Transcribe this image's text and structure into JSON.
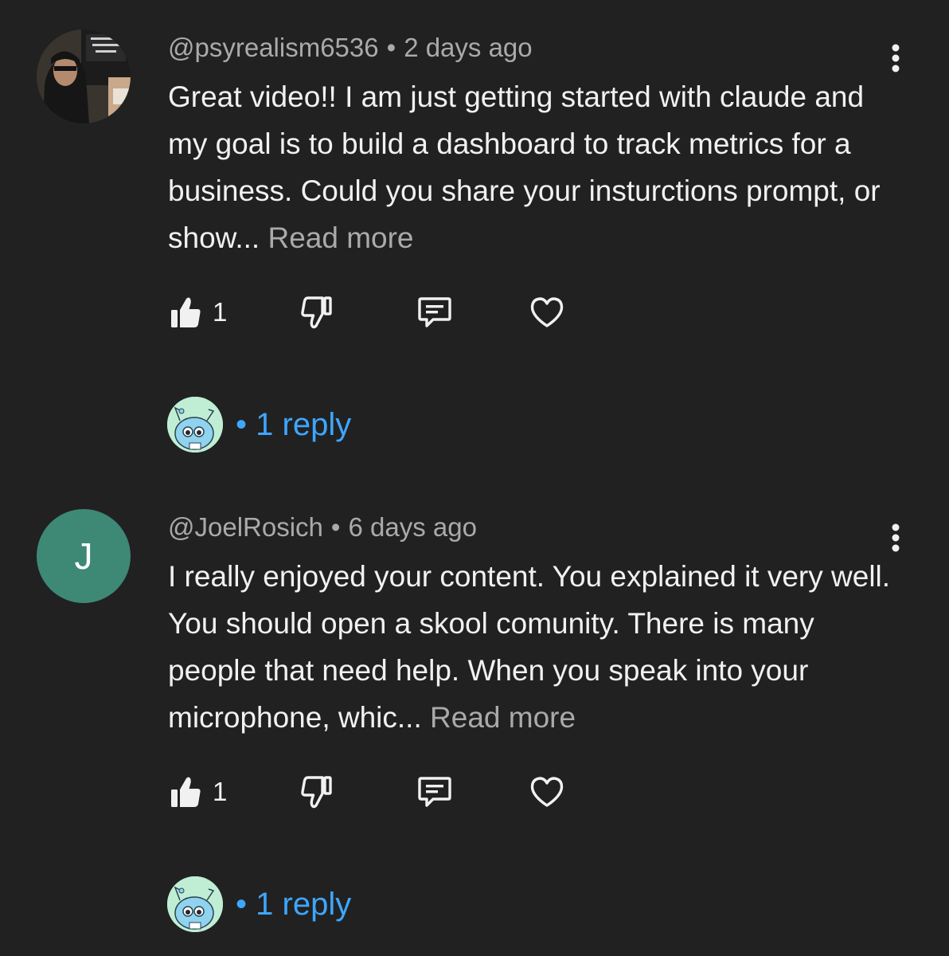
{
  "comments": [
    {
      "author": "@psyrealism6536",
      "time": "2 days ago",
      "text": "Great video!! I am just getting started with claude and my goal is to build a dashboard to track metrics for a business. Could you share your insturctions prompt, or show...",
      "read_more": "Read more",
      "likes": "1",
      "avatar_type": "photo",
      "replies_label": "1 reply"
    },
    {
      "author": "@JoelRosich",
      "time": "6 days ago",
      "text": "I really enjoyed your content. You explained it very well. You should open a skool comunity. There is many people that need help. When you speak into your microphone, whic...",
      "read_more": "Read more",
      "likes": "1",
      "avatar_letter": "J",
      "avatar_type": "letter",
      "replies_label": "1 reply"
    }
  ],
  "separator": "•",
  "colors": {
    "background": "#212121",
    "text": "#f1f1f1",
    "meta": "#aaaaaa",
    "link": "#3ea6ff",
    "letter_avatar": "#3e8876",
    "reply_avatar": "#bfeed5"
  },
  "icons": {
    "menu": "more-vert-icon",
    "like": "thumb-up-icon",
    "dislike": "thumb-down-icon",
    "reply": "comment-icon",
    "heart": "heart-icon"
  }
}
